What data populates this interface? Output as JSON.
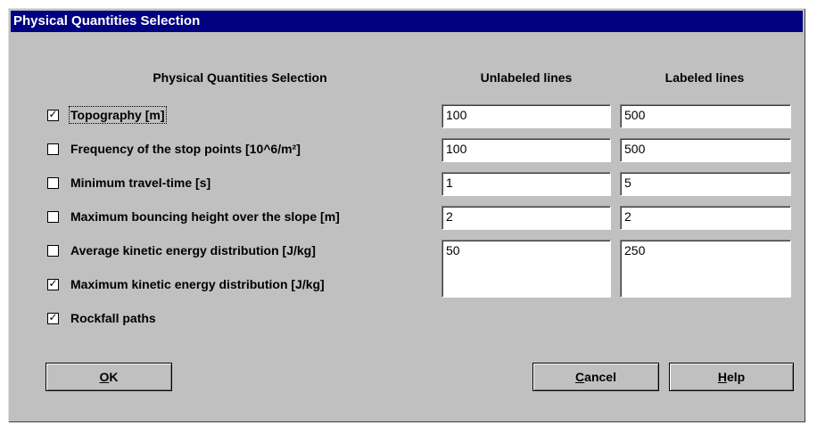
{
  "window": {
    "title": "Physical Quantities Selection"
  },
  "headers": {
    "quantities": "Physical Quantities Selection",
    "unlabeled": "Unlabeled lines",
    "labeled": "Labeled lines"
  },
  "quantities": [
    {
      "label": "Topography [m]",
      "checked": true,
      "unlabeled": "100",
      "labeled": "500"
    },
    {
      "label": "Frequency of the stop points [10^6/m²]",
      "checked": false,
      "unlabeled": "100",
      "labeled": "500"
    },
    {
      "label": "Minimum travel-time [s]",
      "checked": false,
      "unlabeled": "1",
      "labeled": "5"
    },
    {
      "label": "Maximum bouncing height over the slope [m]",
      "checked": false,
      "unlabeled": "2",
      "labeled": "2"
    },
    {
      "label": "Average kinetic energy distribution  [J/kg]",
      "checked": false,
      "unlabeled": "50",
      "labeled": "250"
    },
    {
      "label": "Maximum kinetic energy distribution [J/kg]",
      "checked": true
    },
    {
      "label": "Rockfall paths",
      "checked": true
    }
  ],
  "buttons": {
    "ok_mnemonic": "O",
    "ok_rest": "K",
    "cancel_mnemonic": "C",
    "cancel_rest": "ancel",
    "help_mnemonic": "H",
    "help_rest": "elp"
  },
  "colors": {
    "titlebar": "#000080",
    "dialog_face": "#c0c0c0"
  }
}
